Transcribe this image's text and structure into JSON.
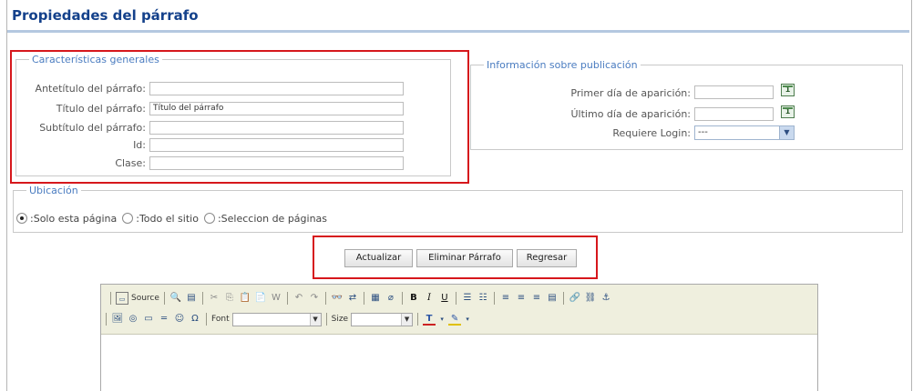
{
  "page": {
    "title": "Propiedades del párrafo"
  },
  "general": {
    "legend": "Características generales",
    "fields": [
      {
        "label": "Antetítulo del párrafo:",
        "value": ""
      },
      {
        "label": "Título del párrafo:",
        "value": "Título del párrafo"
      },
      {
        "label": "Subtítulo del párrafo:",
        "value": ""
      },
      {
        "label": "Id:",
        "value": ""
      },
      {
        "label": "Clase:",
        "value": ""
      }
    ]
  },
  "publication": {
    "legend": "Información sobre publicación",
    "first_day_label": "Primer día de aparición:",
    "first_day_value": "",
    "last_day_label": "Último día de aparición:",
    "last_day_value": "",
    "login_label": "Requiere Login:",
    "login_value": "---"
  },
  "location": {
    "legend": "Ubicación",
    "options": [
      {
        "label": ":Solo esta página",
        "checked": true
      },
      {
        "label": ":Todo el sitio",
        "checked": false
      },
      {
        "label": ":Seleccion de páginas",
        "checked": false
      }
    ]
  },
  "actions": {
    "update": "Actualizar",
    "delete": "Eliminar Párrafo",
    "back": "Regresar"
  },
  "editor": {
    "source_label": "Source",
    "font_label": "Font",
    "font_value": "",
    "size_label": "Size",
    "size_value": "",
    "body_text": ""
  },
  "colors": {
    "title": "#14418b",
    "legend": "#4a7cc0",
    "highlight": "#d6171c"
  }
}
